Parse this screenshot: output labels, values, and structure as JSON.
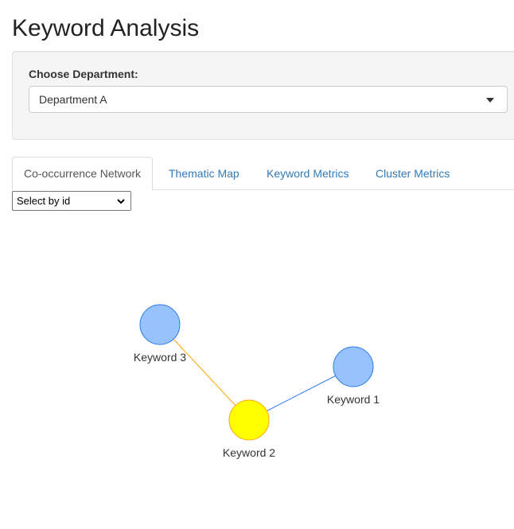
{
  "page": {
    "title": "Keyword Analysis"
  },
  "filters": {
    "department_label": "Choose Department:",
    "department_value": "Department A"
  },
  "tabs": [
    {
      "label": "Co-occurrence Network",
      "active": true
    },
    {
      "label": "Thematic Map",
      "active": false
    },
    {
      "label": "Keyword Metrics",
      "active": false
    },
    {
      "label": "Cluster Metrics",
      "active": false
    }
  ],
  "network": {
    "select_by_id": "Select by id",
    "nodes": [
      {
        "id": "k1",
        "label": "Keyword 1",
        "color": "#97c2fc",
        "border": "#2b7ce9"
      },
      {
        "id": "k2",
        "label": "Keyword 2",
        "color": "#ffff00",
        "border": "#ffa500"
      },
      {
        "id": "k3",
        "label": "Keyword 3",
        "color": "#97c2fc",
        "border": "#2b7ce9"
      }
    ],
    "edges": [
      {
        "from": "k3",
        "to": "k2",
        "color": "#ffa500"
      },
      {
        "from": "k1",
        "to": "k2",
        "color": "#2b7ce9"
      }
    ]
  }
}
